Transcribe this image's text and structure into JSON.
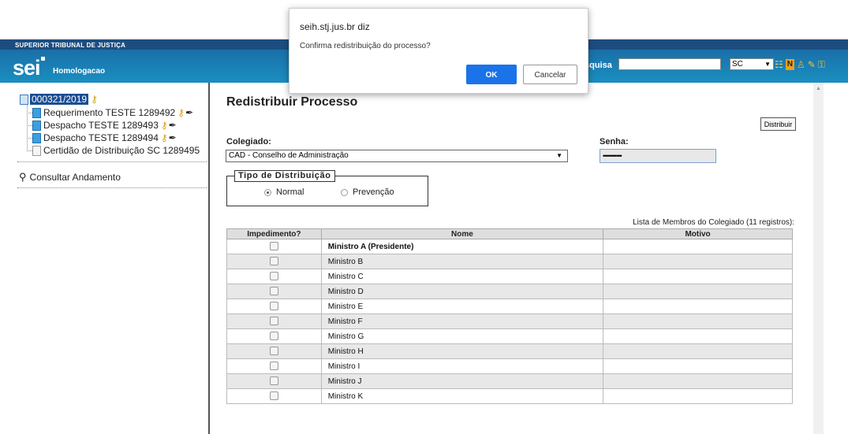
{
  "header": {
    "org_name": "SUPERIOR TRIBUNAL DE JUSTIÇA",
    "logo_text": "sei",
    "environment": "Homologacao",
    "search_label": "squisa",
    "search_value": "",
    "unit_value": "SC",
    "colors": {
      "banner_top": "#1d4d80",
      "banner_bottom": "#1a8fc0"
    }
  },
  "tree": {
    "process_number": "000321/2019",
    "items": [
      {
        "label": "Requerimento TESTE 1289492"
      },
      {
        "label": "Despacho TESTE 1289493"
      },
      {
        "label": "Despacho TESTE 1289494"
      },
      {
        "label": "Certidão de Distribuição SC 1289495"
      }
    ],
    "consultar_label": "Consultar Andamento"
  },
  "main": {
    "title": "Redistribuir Processo",
    "distribuir_label": "Distribuir",
    "colegiado_label": "Colegiado:",
    "colegiado_value": "CAD - Conselho de Administração",
    "senha_label": "Senha:",
    "senha_value": "•••••••••••",
    "tipo_legend": "Tipo de Distribuição",
    "radio_normal": "Normal",
    "radio_prevencao": "Prevenção",
    "lista_caption": "Lista de Membros do Colegiado (11 registros):",
    "table_headers": {
      "impedimento": "Impedimento?",
      "nome": "Nome",
      "motivo": "Motivo"
    },
    "members": [
      "Ministro A (Presidente)",
      "Ministro B",
      "Ministro C",
      "Ministro D",
      "Ministro E",
      "Ministro F",
      "Ministro G",
      "Ministro H",
      "Ministro I",
      "Ministro J",
      "Ministro K"
    ]
  },
  "dialog": {
    "title": "seih.stj.jus.br diz",
    "message": "Confirma redistribuição do processo?",
    "ok_label": "OK",
    "cancel_label": "Cancelar",
    "ok_color": "#1a73e8"
  }
}
